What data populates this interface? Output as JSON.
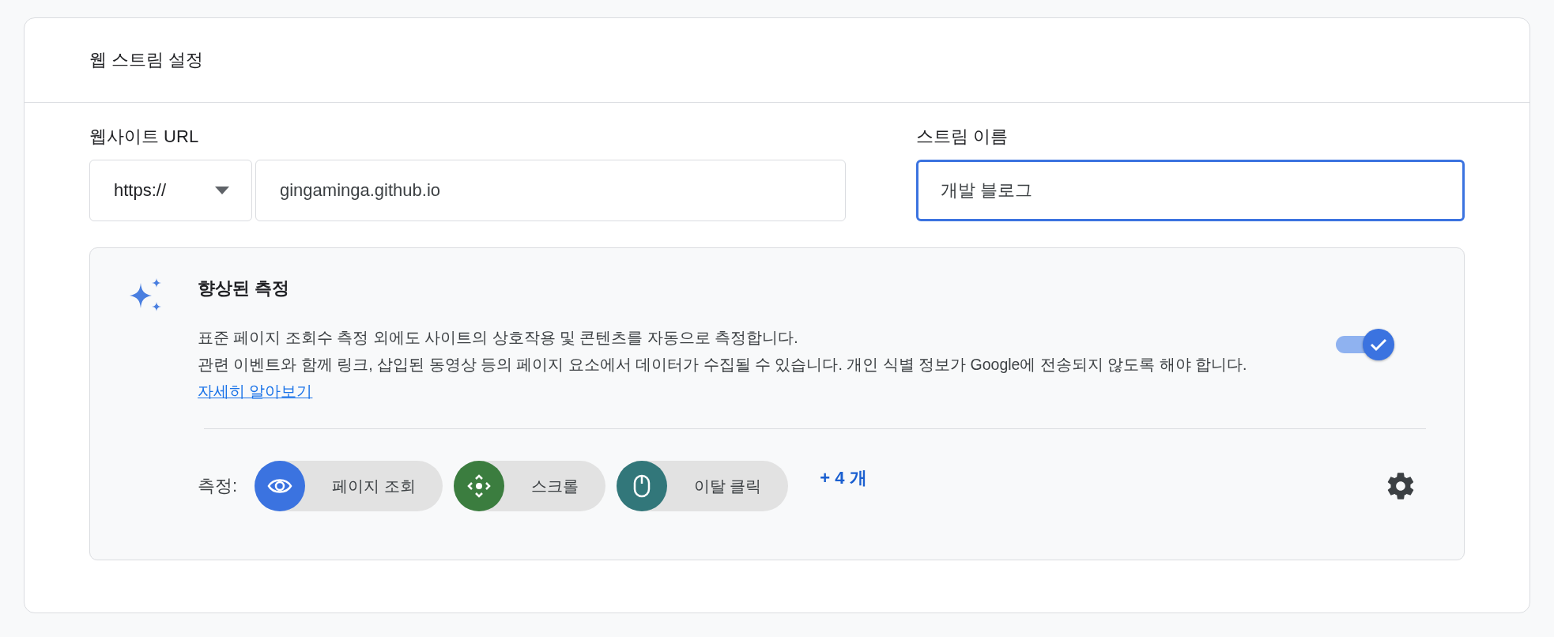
{
  "panel": {
    "title": "웹 스트림 설정"
  },
  "website_url": {
    "label": "웹사이트 URL",
    "protocol": "https://",
    "value": "gingaminga.github.io"
  },
  "stream_name": {
    "label": "스트림 이름",
    "value": "개발 블로그",
    "focused": true
  },
  "enhanced_measurement": {
    "title": "향상된 측정",
    "on": true,
    "description": [
      "표준 페이지 조회수 측정 외에도 사이트의 상호작용 및 콘텐츠를 자동으로 측정합니다.",
      "관련 이벤트와 함께 링크, 삽입된 동영상 등의 페이지 요소에서 데이터가 수집될 수 있습니다. 개인 식별 정보가 Google에 전송되지 않도록 해야 합니다."
    ],
    "link": "자세히 알아보기",
    "measures_label": "측정:",
    "measures": [
      {
        "kind": "eye",
        "label": "페이지 조회",
        "color": "#3b73e0"
      },
      {
        "kind": "scroll",
        "label": "스크롤",
        "color": "#3b7d3f"
      },
      {
        "kind": "mouse",
        "label": "이탈 클릭",
        "color": "#32777a"
      }
    ],
    "more": "+ 4 개"
  }
}
